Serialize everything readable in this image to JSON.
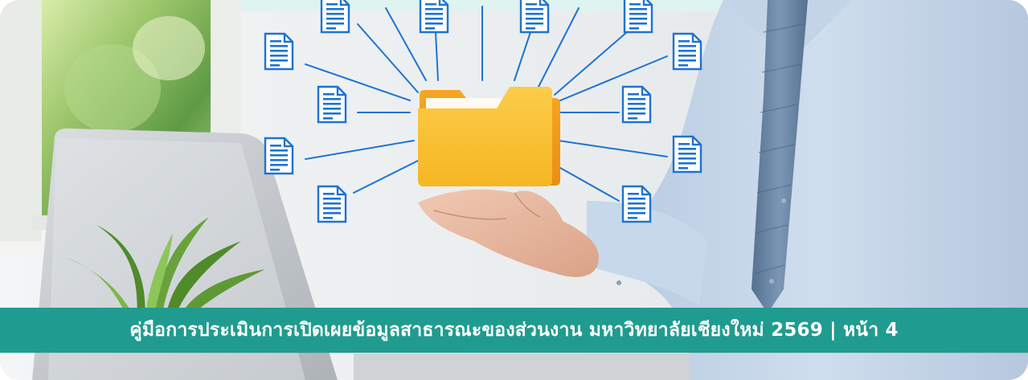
{
  "banner": {
    "caption": "คู่มือการประเมินการเปิดเผยข้อมูลสาธารณะของส่วนงาน มหาวิทยาลัยเชียงใหม่ 2569 | หน้า 4"
  },
  "colors": {
    "caption_bar": "#1f9c8f",
    "caption_text": "#ffffff",
    "icon_blue": "#1e73d2",
    "folder_yellow": "#f9bf2e",
    "shirt": "#c8d9ea",
    "tie": "#6f8dab"
  },
  "icons": {
    "center": "folder-icon",
    "satellites": "document-icon"
  }
}
